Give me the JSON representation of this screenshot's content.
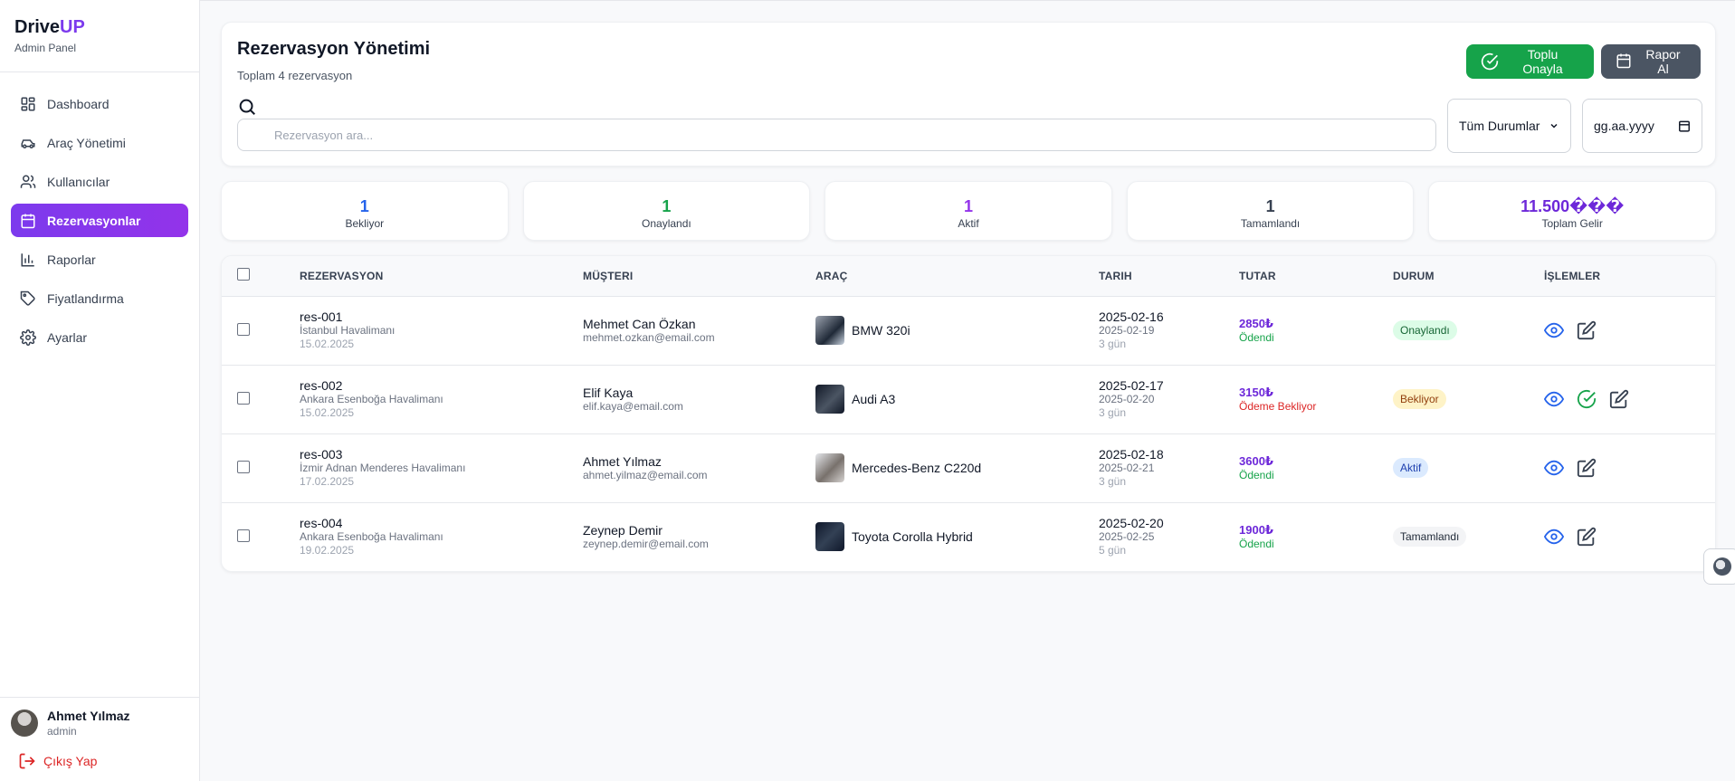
{
  "brand": {
    "name": "Drive",
    "accent": "UP",
    "subtitle": "Admin Panel"
  },
  "sidebar": {
    "items": [
      {
        "label": "Dashboard",
        "icon": "dashboard-icon"
      },
      {
        "label": "Araç Yönetimi",
        "icon": "car-icon"
      },
      {
        "label": "Kullanıcılar",
        "icon": "users-icon"
      },
      {
        "label": "Rezervasyonlar",
        "icon": "calendar-icon",
        "active": true
      },
      {
        "label": "Raporlar",
        "icon": "bar-chart-icon"
      },
      {
        "label": "Fiyatlandırma",
        "icon": "tag-icon"
      },
      {
        "label": "Ayarlar",
        "icon": "gear-icon"
      }
    ]
  },
  "user": {
    "name": "Ahmet Yılmaz",
    "role": "admin",
    "logout_label": "Çıkış Yap"
  },
  "header": {
    "title": "Rezervasyon Yönetimi",
    "subtitle": "Toplam 4 rezervasyon",
    "bulk_approve_label": "Toplu Onayla",
    "report_label": "Rapor Al"
  },
  "filters": {
    "search_placeholder": "Rezervasyon ara...",
    "status_value": "Tüm Durumlar",
    "date_placeholder": "gg.aa.yyyy"
  },
  "stats": [
    {
      "value": "1",
      "label": "Bekliyor",
      "color": "#2563eb"
    },
    {
      "value": "1",
      "label": "Onaylandı",
      "color": "#16a34a"
    },
    {
      "value": "1",
      "label": "Aktif",
      "color": "#9333ea"
    },
    {
      "value": "1",
      "label": "Tamamlandı",
      "color": "#374151"
    },
    {
      "value": "11.500���",
      "label": "Toplam Gelir",
      "color": "#6d28d9"
    }
  ],
  "table": {
    "headers": [
      "REZERVASYON",
      "MÜŞTERI",
      "ARAÇ",
      "TARIH",
      "TUTAR",
      "DURUM",
      "İŞLEMLER"
    ],
    "rows": [
      {
        "id": "res-001",
        "location": "İstanbul Havalimanı",
        "created": "15.02.2025",
        "customer": "Mehmet Can Özkan",
        "email": "mehmet.ozkan@email.com",
        "car": "BMW 320i",
        "start": "2025-02-16",
        "end": "2025-02-19",
        "days": "3 gün",
        "amount": "2850₺",
        "payment": "Ödendi",
        "paid": true,
        "status": "Onaylandı",
        "status_kind": "green"
      },
      {
        "id": "res-002",
        "location": "Ankara Esenboğa Havalimanı",
        "created": "15.02.2025",
        "customer": "Elif Kaya",
        "email": "elif.kaya@email.com",
        "car": "Audi A3",
        "start": "2025-02-17",
        "end": "2025-02-20",
        "days": "3 gün",
        "amount": "3150₺",
        "payment": "Ödeme Bekliyor",
        "paid": false,
        "status": "Bekliyor",
        "status_kind": "yellow"
      },
      {
        "id": "res-003",
        "location": "İzmir Adnan Menderes Havalimanı",
        "created": "17.02.2025",
        "customer": "Ahmet Yılmaz",
        "email": "ahmet.yilmaz@email.com",
        "car": "Mercedes-Benz C220d",
        "start": "2025-02-18",
        "end": "2025-02-21",
        "days": "3 gün",
        "amount": "3600₺",
        "payment": "Ödendi",
        "paid": true,
        "status": "Aktif",
        "status_kind": "blue"
      },
      {
        "id": "res-004",
        "location": "Ankara Esenboğa Havalimanı",
        "created": "19.02.2025",
        "customer": "Zeynep Demir",
        "email": "zeynep.demir@email.com",
        "car": "Toyota Corolla Hybrid",
        "start": "2025-02-20",
        "end": "2025-02-25",
        "days": "5 gün",
        "amount": "1900₺",
        "payment": "Ödendi",
        "paid": true,
        "status": "Tamamlandı",
        "status_kind": "gray"
      }
    ]
  }
}
